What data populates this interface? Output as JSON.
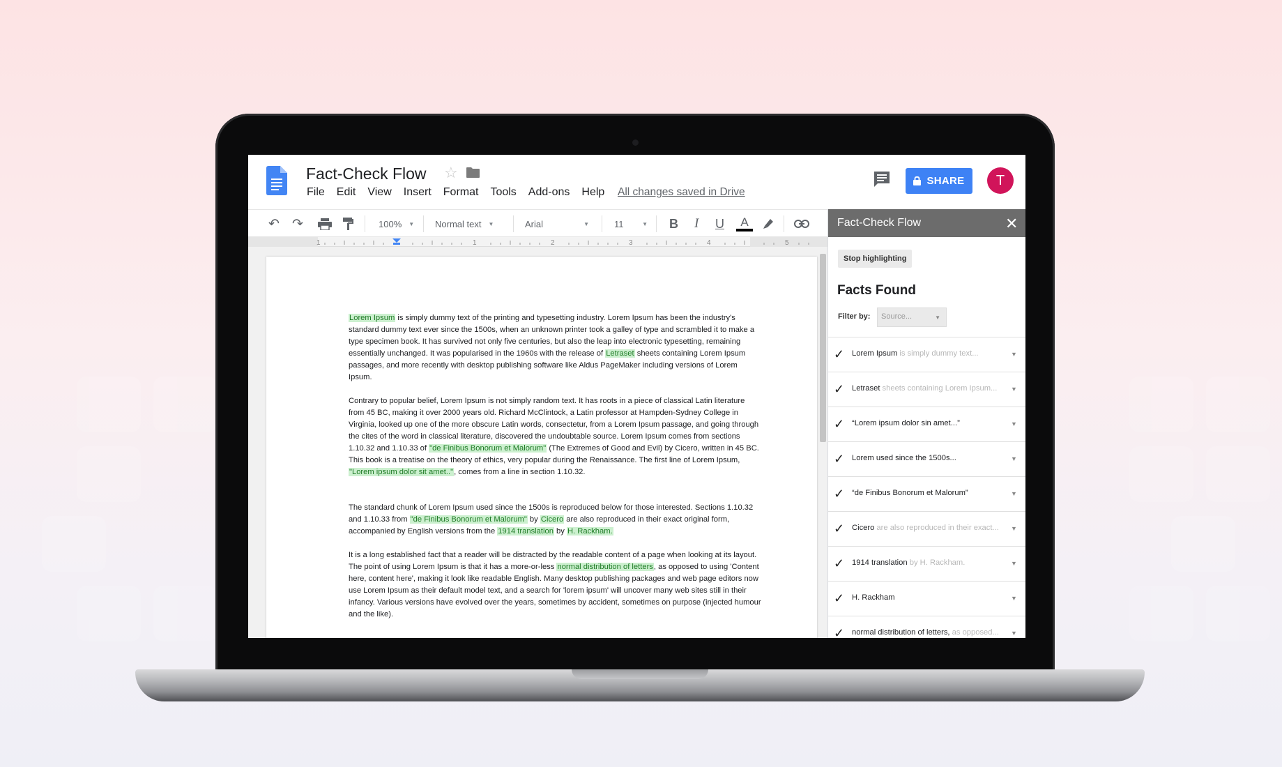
{
  "app": {
    "doc_title": "Fact-Check Flow",
    "menu": [
      "File",
      "Edit",
      "View",
      "Insert",
      "Format",
      "Tools",
      "Add-ons",
      "Help"
    ],
    "saved_status": "All changes saved in Drive",
    "share_label": "SHARE",
    "avatar_initial": "T"
  },
  "toolbar": {
    "zoom": "100%",
    "style": "Normal text",
    "font": "Arial",
    "font_size": "11",
    "bold": "B",
    "italic": "I",
    "underline": "U",
    "text_color_letter": "A",
    "ruler_numbers": [
      "1",
      "1",
      "2",
      "3",
      "4",
      "5"
    ]
  },
  "document": {
    "p1": {
      "hl1": "Lorem Ipsum",
      "t1": " is simply dummy text of the printing and typesetting industry. Lorem Ipsum has been the industry's standard dummy text ever since the 1500s, when an unknown printer took a galley of type and scrambled it to make a type specimen book. It has survived not only five centuries, but also the leap into electronic typesetting, remaining essentially unchanged. It was popularised in the 1960s with the release of ",
      "hl2": "Letraset",
      "t2": " sheets containing Lorem Ipsum passages, and more recently with desktop publishing software like Aldus PageMaker including versions of Lorem Ipsum."
    },
    "p2": {
      "t1": "Contrary to popular belief, Lorem Ipsum is not simply random text. It has roots in a piece of classical Latin literature from 45 BC, making it over 2000 years old. Richard McClintock, a Latin professor at Hampden-Sydney College in Virginia, looked up one of the more obscure Latin words, consectetur, from a Lorem Ipsum passage, and going through the cites of the word in classical literature, discovered the undoubtable source. Lorem Ipsum comes from sections 1.10.32 and 1.10.33 of ",
      "hl1": "\"de Finibus Bonorum et Malorum\"",
      "t2": " (The Extremes of Good and Evil) by Cicero, written in 45 BC. This book is a treatise on the theory of ethics, very popular during the Renaissance. The first line of Lorem Ipsum, ",
      "hl2": "\"Lorem ipsum dolor sit amet..\"",
      "t3": ", comes from a line in section 1.10.32."
    },
    "p3": {
      "t1": "The standard chunk of Lorem Ipsum used since the 1500s is reproduced below for those interested. Sections 1.10.32 and 1.10.33 from ",
      "hl1": "\"de Finibus Bonorum et Malorum\"",
      "t2": " by ",
      "hl2": "Cicero",
      "t3": " are also reproduced in their exact original form, accompanied by English versions from the ",
      "hl3": "1914 translation",
      "t4": " by ",
      "hl4": "H. Rackham."
    },
    "p4": {
      "t1": "It is a long established fact that a reader will be distracted by the readable content of a page when looking at its layout. The point of using Lorem Ipsum is that it has a more-or-less ",
      "hl1": "normal distribution of letters",
      "t2": ", as opposed to using 'Content here, content here', making it look like readable English. Many desktop publishing packages and web page editors now use Lorem Ipsum as their default model text, and a search for 'lorem ipsum' will uncover many web sites still in their infancy. Various versions have evolved over the years, sometimes by accident, sometimes on purpose (injected humour and the like)."
    }
  },
  "panel": {
    "title": "Fact-Check Flow",
    "stop_label": "Stop highlighting",
    "facts_title": "Facts Found",
    "filter_label": "Filter by:",
    "filter_placeholder": "Source...",
    "facts": [
      {
        "main": "Lorem Ipsum",
        "context": " is simply dummy text..."
      },
      {
        "main": "Letraset",
        "context": " sheets containing Lorem Ipsum..."
      },
      {
        "main": "“Lorem ipsum dolor sin amet...”",
        "context": ""
      },
      {
        "main": "Lorem used since the 1500s...",
        "context": ""
      },
      {
        "main": "“de Finibus Bonorum et Malorum”",
        "context": ""
      },
      {
        "main": "Cicero",
        "context": " are also reproduced in their exact..."
      },
      {
        "main": "1914 translation",
        "context": " by H. Rackham."
      },
      {
        "main": "H. Rackham",
        "context": ""
      },
      {
        "main": "normal distribution of letters,",
        "context": "  as opposed..."
      }
    ]
  },
  "colors": {
    "share_blue": "#3e82f5",
    "avatar_pink": "#d1145a",
    "highlight_green": "#ccf0cf",
    "panel_header": "#6c6c6c"
  }
}
